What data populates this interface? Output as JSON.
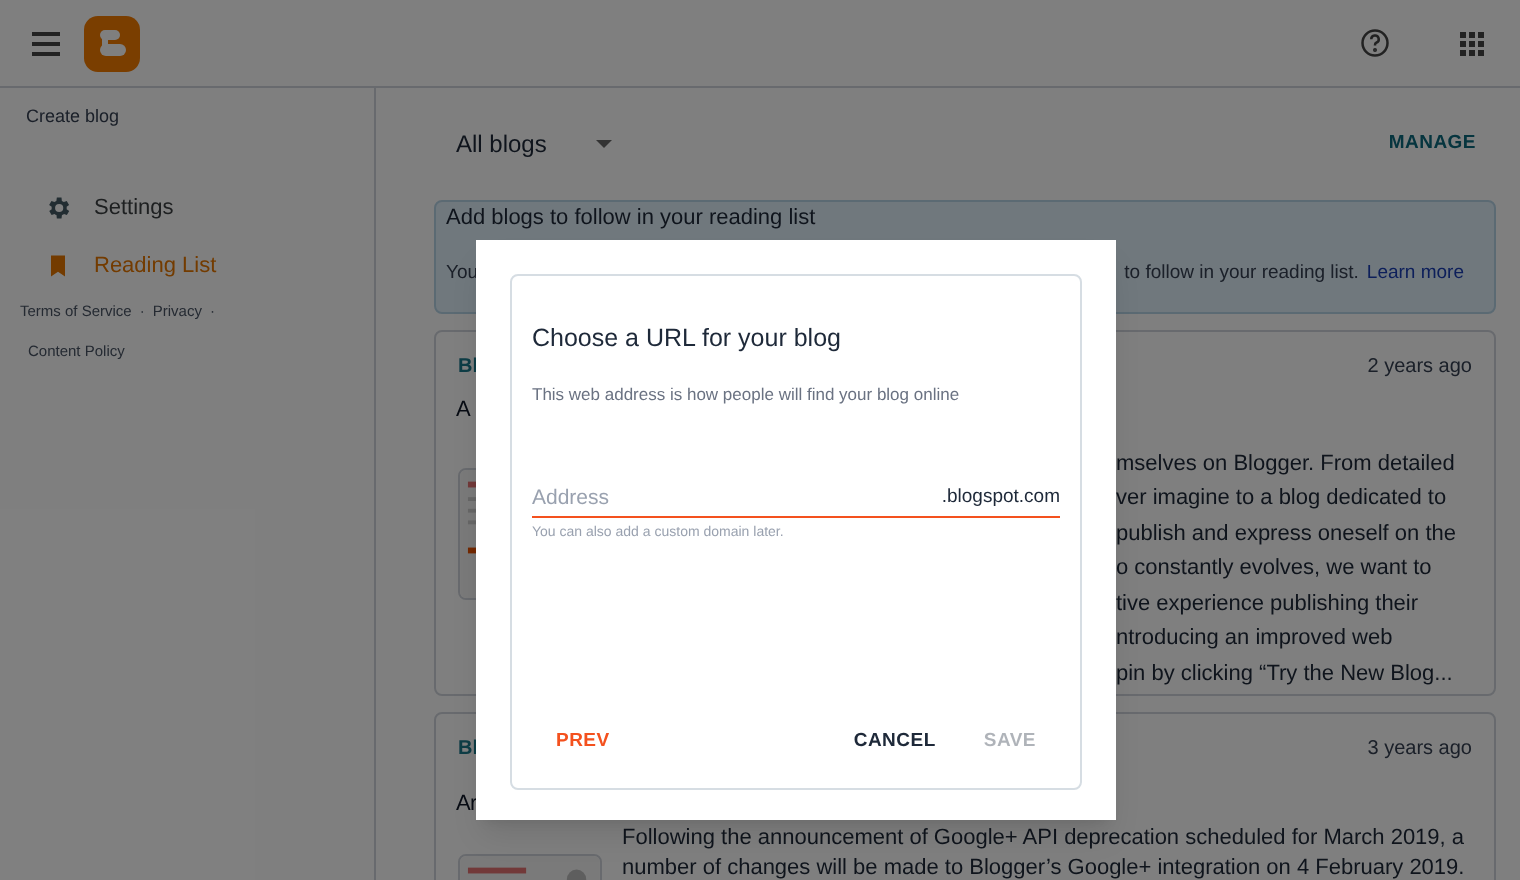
{
  "sidebar": {
    "create_blog": "Create blog",
    "items": [
      {
        "label": "Settings",
        "kind": "settings",
        "selected": false
      },
      {
        "label": "Reading List",
        "kind": "reading",
        "selected": true
      }
    ],
    "footer_links": [
      "Terms of Service",
      "Privacy",
      "Content Policy"
    ],
    "separator": "·"
  },
  "main": {
    "filter": "All blogs",
    "manage": "MANAGE",
    "banner": {
      "title": "Add blogs to follow in your reading list",
      "text_start": "You",
      "text_end": "to follow in your reading list.",
      "link": "Learn more"
    },
    "posts": [
      {
        "blog": "Bl",
        "title": "A",
        "time": "2 years ago",
        "body_lines": [
          "mselves on Blogger. From detailed",
          "ver imagine to a blog dedicated to",
          "publish and express oneself on the",
          "o constantly evolves, we want to",
          "tive experience publishing their",
          "ntroducing an improved web",
          "pin by clicking “Try the New Blog..."
        ]
      },
      {
        "blog": "Bl",
        "title": "Ar",
        "time": "3 years ago",
        "body_lines": [
          "Following the announcement of Google+ API deprecation scheduled for March 2019, a",
          "number of changes will be made to Blogger’s Google+ integration on 4 February 2019."
        ]
      }
    ]
  },
  "dialog": {
    "title": "Choose a URL for your blog",
    "subtitle": "This web address is how people will find your blog online",
    "field": {
      "placeholder": "Address",
      "suffix": ".blogspot.com"
    },
    "hint": "You can also add a custom domain later.",
    "buttons": [
      {
        "label": "PREV",
        "kind": "accent",
        "disabled": false
      },
      {
        "label": "CANCEL",
        "kind": "plain",
        "disabled": false
      },
      {
        "label": "SAVE",
        "kind": "plain",
        "disabled": true
      }
    ]
  }
}
